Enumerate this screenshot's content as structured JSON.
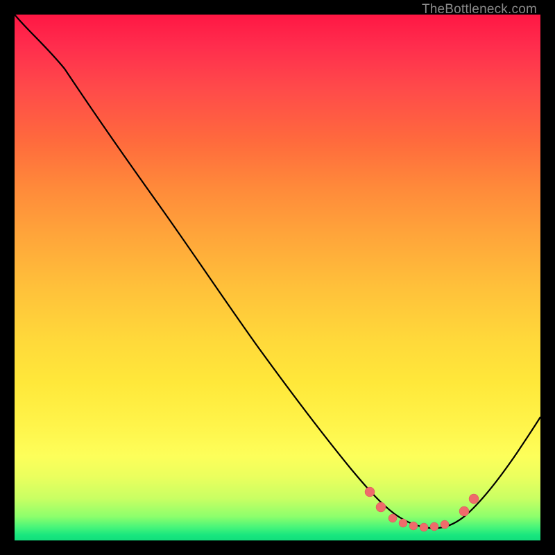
{
  "watermark": "TheBottleneck.com",
  "chart_data": {
    "type": "line",
    "title": "",
    "xlabel": "",
    "ylabel": "",
    "xlim": [
      0,
      100
    ],
    "ylim": [
      0,
      100
    ],
    "grid": false,
    "background_gradient": {
      "top": "#ff1744",
      "bottom": "#12df7c",
      "note": "red→yellow→green vertical gradient; y proxies bottleneck %"
    },
    "series": [
      {
        "name": "bottleneck-curve",
        "color": "#000000",
        "x": [
          0,
          4,
          10,
          17,
          25,
          33,
          42,
          50,
          58,
          64,
          68,
          71,
          74,
          77,
          80,
          83,
          86,
          90,
          94,
          100
        ],
        "y": [
          100,
          97,
          92,
          85,
          76,
          67,
          57,
          47,
          37,
          29,
          22,
          15,
          9,
          5,
          3,
          3,
          5,
          10,
          17,
          28
        ]
      }
    ],
    "markers": {
      "name": "highlight-dots",
      "color": "#ef6b6b",
      "radius_px": 6,
      "points": [
        {
          "x": 68,
          "y": 15
        },
        {
          "x": 70,
          "y": 9
        },
        {
          "x": 73,
          "y": 5
        },
        {
          "x": 75,
          "y": 4
        },
        {
          "x": 77,
          "y": 3
        },
        {
          "x": 79,
          "y": 3
        },
        {
          "x": 81,
          "y": 3
        },
        {
          "x": 83,
          "y": 4
        },
        {
          "x": 86,
          "y": 8
        },
        {
          "x": 88,
          "y": 13
        }
      ]
    }
  }
}
